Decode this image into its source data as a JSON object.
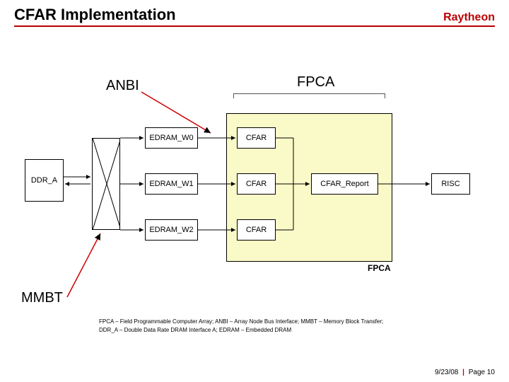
{
  "header": {
    "title": "CFAR Implementation",
    "logo": "Raytheon"
  },
  "labels": {
    "anbi": "ANBI",
    "fpca": "FPCA",
    "mmbt": "MMBT",
    "fpca_box": "FPCA"
  },
  "blocks": {
    "ddr_a": "DDR_A",
    "edram0": "EDRAM_W0",
    "edram1": "EDRAM_W1",
    "edram2": "EDRAM_W2",
    "cfar0": "CFAR",
    "cfar1": "CFAR",
    "cfar2": "CFAR",
    "report": "CFAR_Report",
    "risc": "RISC"
  },
  "footnote": {
    "line1": "FPCA – Field Programmable Computer Array; ANBI – Array Node Bus Interface; MMBT – Memory Block Transfer;",
    "line2": "DDR_A – Double Data Rate DRAM Interface A; EDRAM – Embedded DRAM"
  },
  "footer": {
    "date": "9/23/08",
    "page": "Page 10"
  }
}
